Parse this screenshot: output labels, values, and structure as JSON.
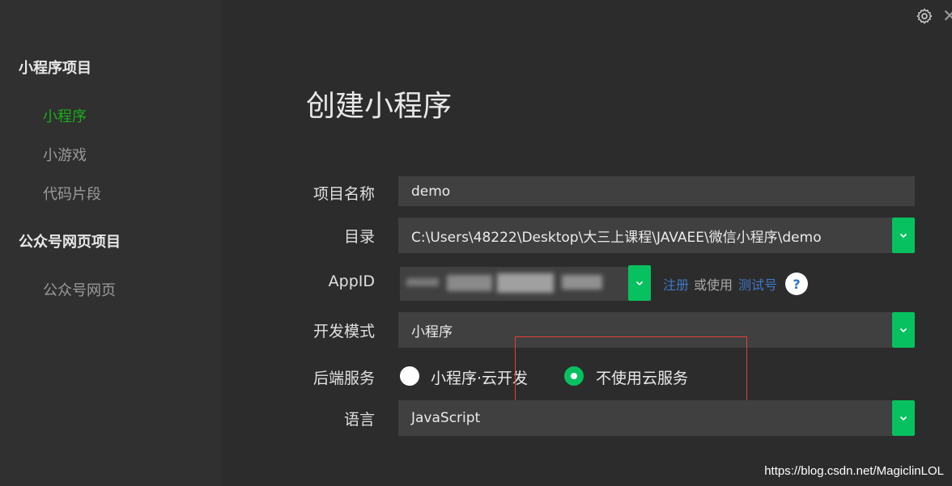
{
  "sidebar": {
    "group1": "小程序项目",
    "items1": [
      "小程序",
      "小游戏",
      "代码片段"
    ],
    "group2": "公众号网页项目",
    "items2": [
      "公众号网页"
    ]
  },
  "main": {
    "title": "创建小程序",
    "labels": {
      "name": "项目名称",
      "dir": "目录",
      "appid": "AppID",
      "mode": "开发模式",
      "backend": "后端服务",
      "lang": "语言"
    },
    "values": {
      "name": "demo",
      "dir": "C:\\Users\\48222\\Desktop\\大三上课程\\JAVAEE\\微信小程序\\demo",
      "mode": "小程序",
      "lang": "JavaScript"
    },
    "appid_links": {
      "register": "注册",
      "or_use": "或使用",
      "test_id": "测试号",
      "help": "?"
    },
    "backend_options": [
      "小程序·云开发",
      "不使用云服务"
    ],
    "backend_selected": 1
  },
  "colors": {
    "accent": "#07c160",
    "active_sidebar": "#1aad19",
    "link": "#3e78c8",
    "highlight": "#e0403a"
  },
  "watermark": "https://blog.csdn.net/MagiclinLOL"
}
